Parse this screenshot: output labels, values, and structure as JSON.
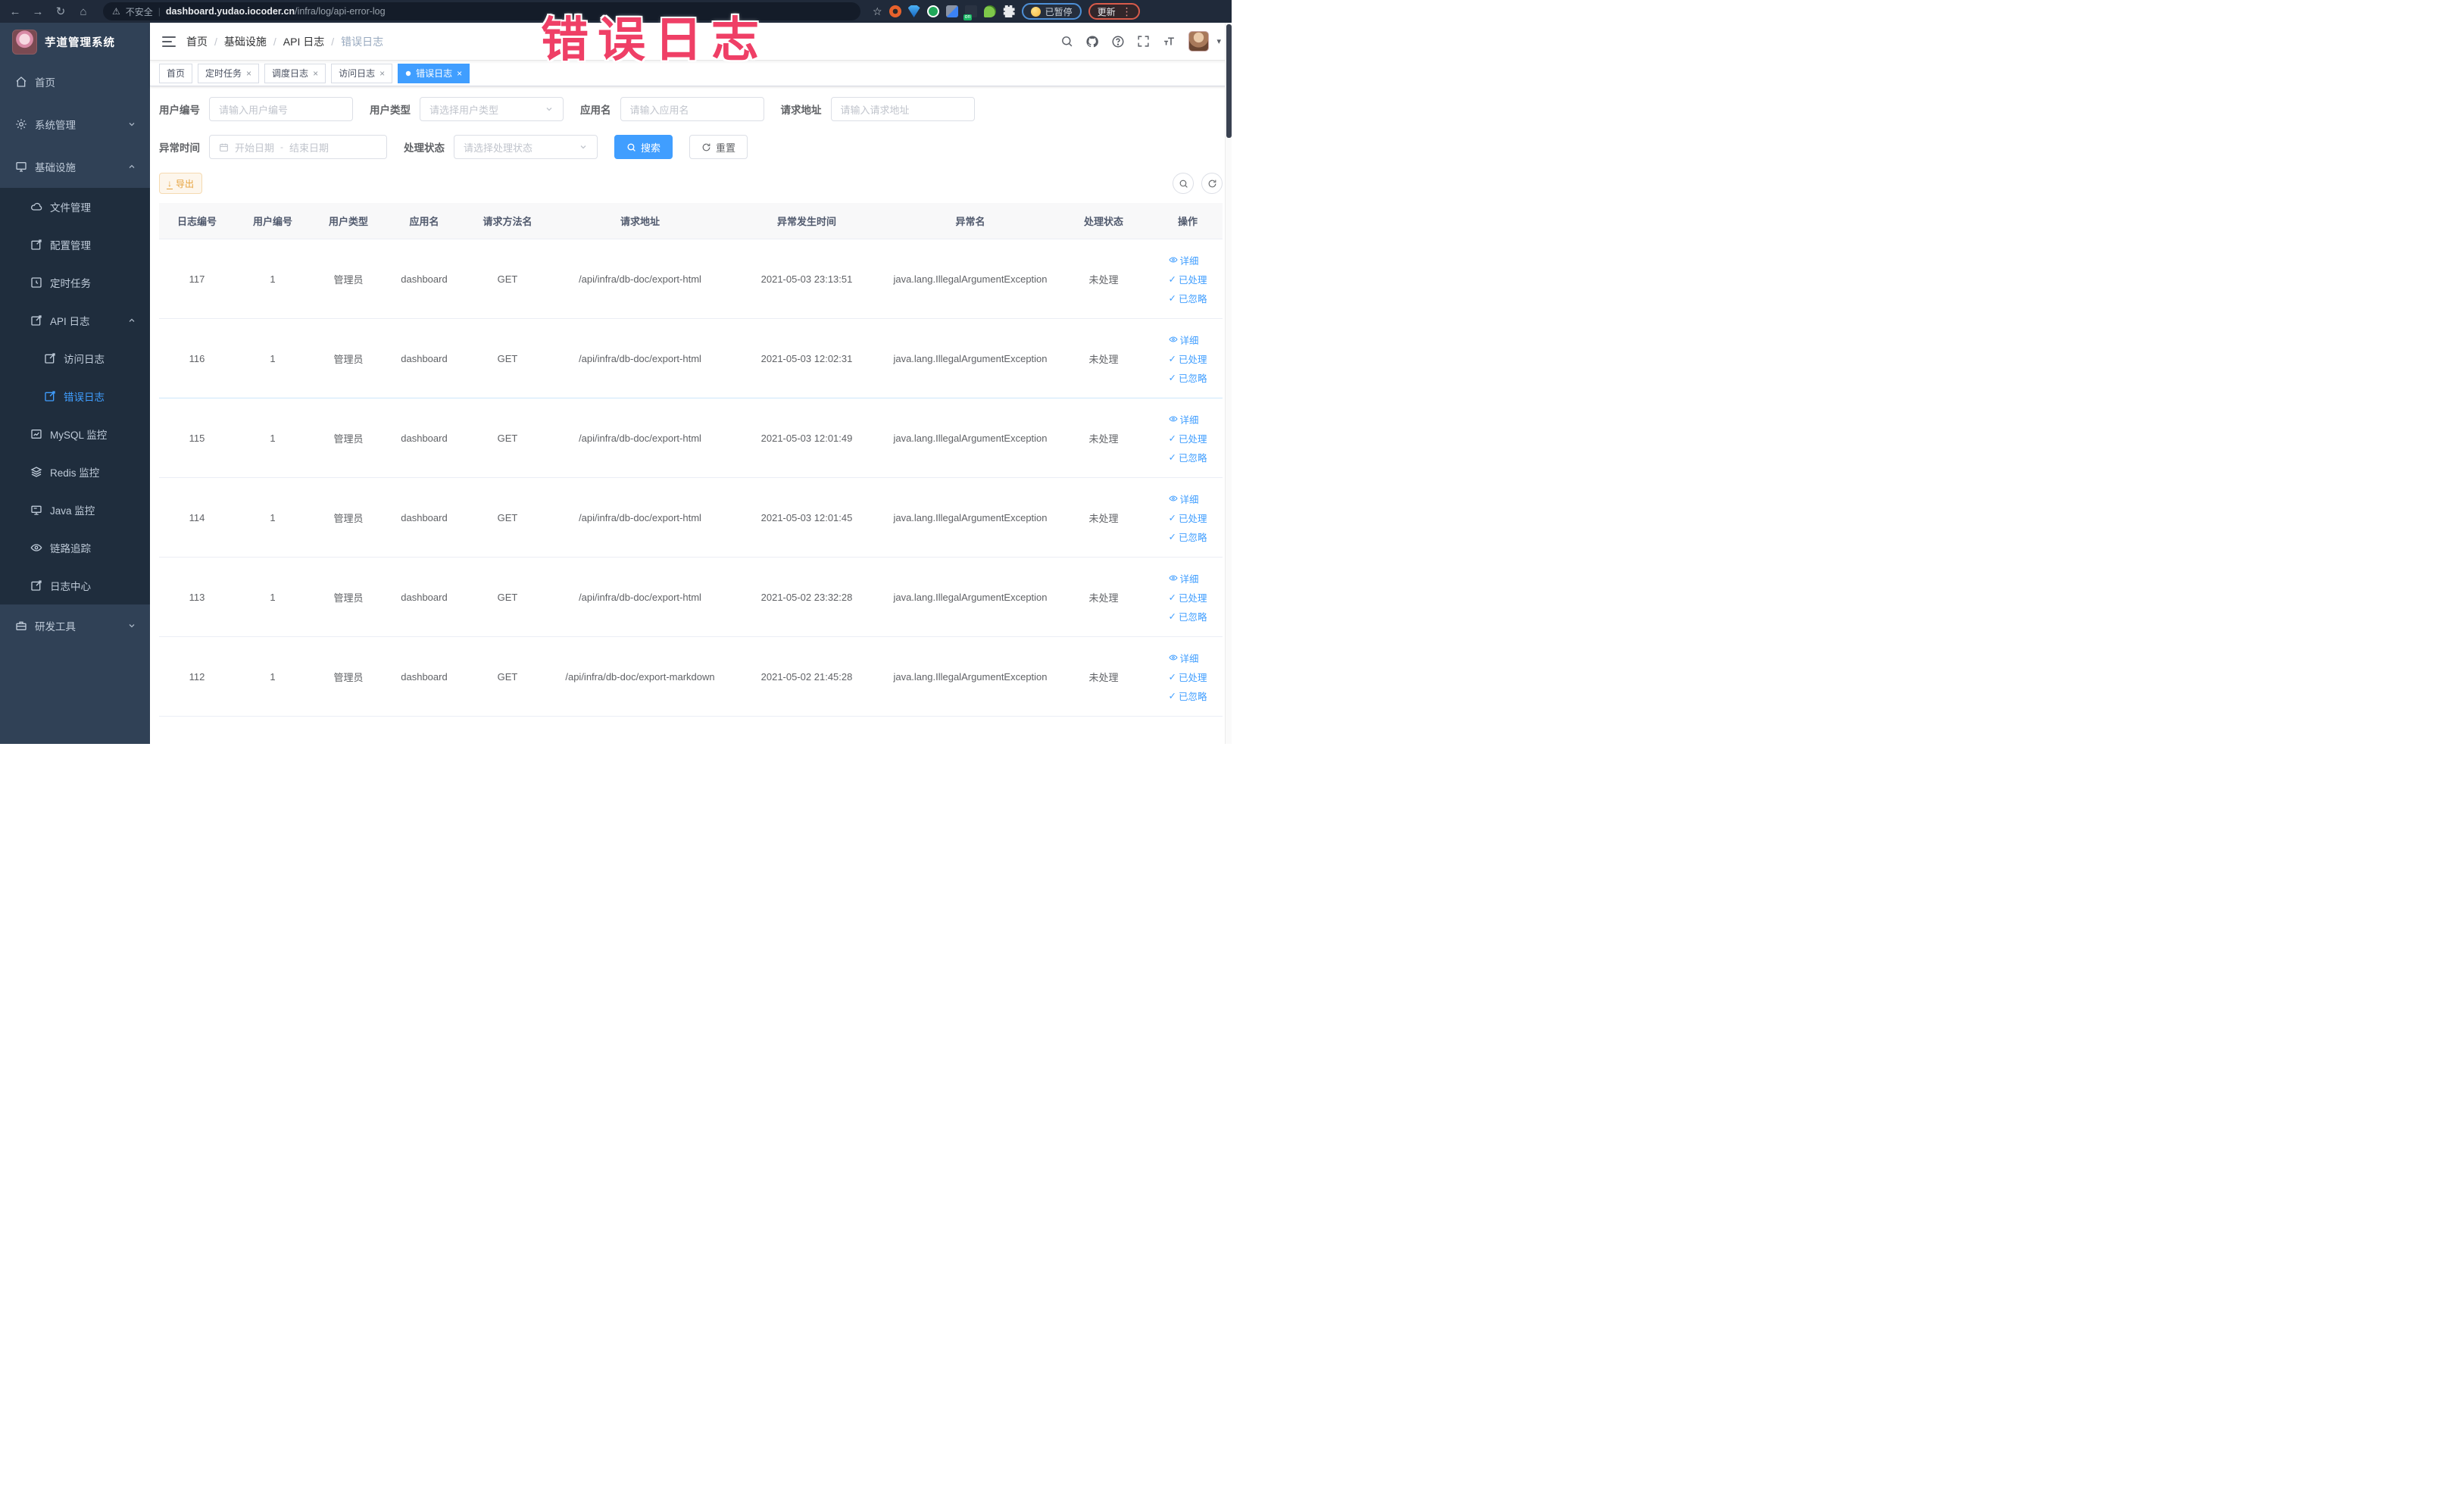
{
  "browser": {
    "security_label": "不安全",
    "url_host": "dashboard.yudao.iocoder.cn",
    "url_path": "/infra/log/api-error-log",
    "paused_label": "已暂停",
    "update_label": "更新"
  },
  "watermark": "错误日志",
  "icons": {
    "back": "←",
    "forward": "→",
    "reload": "↻",
    "home": "⌂",
    "warning": "⚠",
    "pipe": "|",
    "star": "☆",
    "kebab": "⋮",
    "close": "×",
    "check": "✓",
    "active_dot": "",
    "caret": "▾",
    "download": "↓",
    "breadcrumb_separator": "/"
  },
  "sidebar": {
    "title": "芋道管理系统",
    "items": [
      {
        "label": "首页"
      },
      {
        "label": "系统管理"
      },
      {
        "label": "基础设施"
      },
      {
        "label": "文件管理"
      },
      {
        "label": "配置管理"
      },
      {
        "label": "定时任务"
      },
      {
        "label": "API 日志"
      },
      {
        "label": "访问日志"
      },
      {
        "label": "错误日志"
      },
      {
        "label": "MySQL 监控"
      },
      {
        "label": "Redis 监控"
      },
      {
        "label": "Java 监控"
      },
      {
        "label": "链路追踪"
      },
      {
        "label": "日志中心"
      },
      {
        "label": "研发工具"
      }
    ]
  },
  "breadcrumb": [
    "首页",
    "基础设施",
    "API 日志",
    "错误日志"
  ],
  "tabs": [
    {
      "label": "首页"
    },
    {
      "label": "定时任务"
    },
    {
      "label": "调度日志"
    },
    {
      "label": "访问日志"
    },
    {
      "label": "错误日志"
    }
  ],
  "filters": {
    "user_id_label": "用户编号",
    "user_id_placeholder": "请输入用户编号",
    "user_type_label": "用户类型",
    "user_type_placeholder": "请选择用户类型",
    "app_name_label": "应用名",
    "app_name_placeholder": "请输入应用名",
    "request_url_label": "请求地址",
    "request_url_placeholder": "请输入请求地址",
    "exception_time_label": "异常时间",
    "start_date_placeholder": "开始日期",
    "range_separator": "-",
    "end_date_placeholder": "结束日期",
    "process_status_label": "处理状态",
    "process_status_placeholder": "请选择处理状态",
    "search_label": "搜索",
    "reset_label": "重置"
  },
  "toolbar": {
    "export_label": "导出"
  },
  "table": {
    "columns": [
      "日志编号",
      "用户编号",
      "用户类型",
      "应用名",
      "请求方法名",
      "请求地址",
      "异常发生时间",
      "异常名",
      "处理状态",
      "操作"
    ],
    "actions": {
      "detail": "详细",
      "processed": "已处理",
      "ignored": "已忽略"
    },
    "rows": [
      {
        "id": "117",
        "user_id": "1",
        "user_type": "管理员",
        "app_name": "dashboard",
        "method": "GET",
        "url": "/api/infra/db-doc/export-html",
        "time": "2021-05-03 23:13:51",
        "exception": "java.lang.IllegalArgumentException",
        "status": "未处理"
      },
      {
        "id": "116",
        "user_id": "1",
        "user_type": "管理员",
        "app_name": "dashboard",
        "method": "GET",
        "url": "/api/infra/db-doc/export-html",
        "time": "2021-05-03 12:02:31",
        "exception": "java.lang.IllegalArgumentException",
        "status": "未处理"
      },
      {
        "id": "115",
        "user_id": "1",
        "user_type": "管理员",
        "app_name": "dashboard",
        "method": "GET",
        "url": "/api/infra/db-doc/export-html",
        "time": "2021-05-03 12:01:49",
        "exception": "java.lang.IllegalArgumentException",
        "status": "未处理"
      },
      {
        "id": "114",
        "user_id": "1",
        "user_type": "管理员",
        "app_name": "dashboard",
        "method": "GET",
        "url": "/api/infra/db-doc/export-html",
        "time": "2021-05-03 12:01:45",
        "exception": "java.lang.IllegalArgumentException",
        "status": "未处理"
      },
      {
        "id": "113",
        "user_id": "1",
        "user_type": "管理员",
        "app_name": "dashboard",
        "method": "GET",
        "url": "/api/infra/db-doc/export-html",
        "time": "2021-05-02 23:32:28",
        "exception": "java.lang.IllegalArgumentException",
        "status": "未处理"
      },
      {
        "id": "112",
        "user_id": "1",
        "user_type": "管理员",
        "app_name": "dashboard",
        "method": "GET",
        "url": "/api/infra/db-doc/export-markdown",
        "time": "2021-05-02 21:45:28",
        "exception": "java.lang.IllegalArgumentException",
        "status": "未处理"
      }
    ]
  },
  "colors": {
    "accent_blue": "#409eff",
    "warning_orange": "#e6a23c",
    "watermark_pink": "#ef3f66",
    "sidebar_bg": "#304156",
    "submenu_bg": "#1f2d3d",
    "active_tab_bg": "#409eff"
  }
}
